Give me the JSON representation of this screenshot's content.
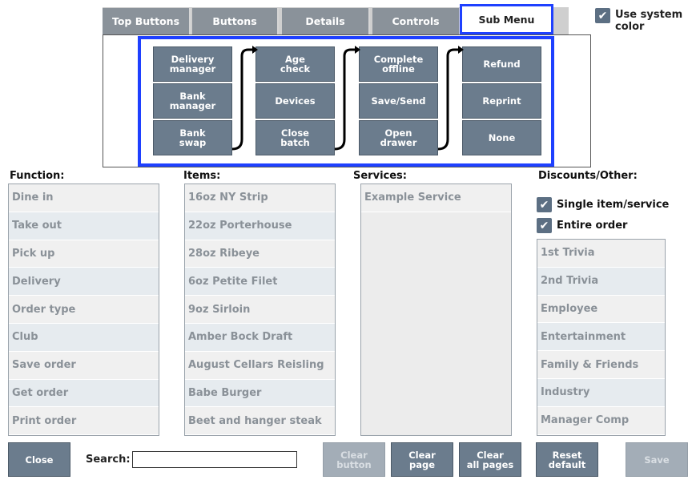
{
  "tabs": [
    {
      "label": "Top Buttons"
    },
    {
      "label": "Buttons"
    },
    {
      "label": "Details"
    },
    {
      "label": "Controls"
    },
    {
      "label": "Sub Menu"
    }
  ],
  "use_system_color": {
    "label": "Use system color",
    "checked": true
  },
  "submenu": {
    "columns": [
      [
        "Delivery\nmanager",
        "Bank\nmanager",
        "Bank\nswap"
      ],
      [
        "Age\ncheck",
        "Devices",
        "Close\nbatch"
      ],
      [
        "Complete\noffline",
        "Save/Send",
        "Open\ndrawer"
      ],
      [
        "Refund",
        "Reprint",
        "None"
      ]
    ]
  },
  "function": {
    "title": "Function:",
    "items": [
      "Dine in",
      "Take out",
      "Pick up",
      "Delivery",
      "Order type",
      "Club",
      "Save order",
      "Get order",
      "Print order"
    ]
  },
  "items": {
    "title": "Items:",
    "items": [
      "16oz NY Strip",
      "22oz Porterhouse",
      "28oz Ribeye",
      "6oz Petite Filet",
      "9oz Sirloin",
      "Amber Bock Draft",
      "August Cellars Reisling",
      "Babe Burger",
      "Beet and hanger steak"
    ]
  },
  "services": {
    "title": "Services:",
    "items": [
      "Example Service"
    ]
  },
  "discounts": {
    "title": "Discounts/Other:",
    "single_item": {
      "label": "Single item/service",
      "checked": true
    },
    "entire_order": {
      "label": "Entire order",
      "checked": true
    },
    "items": [
      "1st Trivia",
      "2nd Trivia",
      "Employee",
      "Entertainment",
      "Family & Friends",
      "Industry",
      "Manager Comp"
    ]
  },
  "bottom": {
    "close": "Close",
    "search_label": "Search:",
    "search_value": "",
    "clear_button": "Clear\nbutton",
    "clear_page": "Clear\npage",
    "clear_all_pages": "Clear\nall pages",
    "reset_default": "Reset\ndefault",
    "save": "Save"
  },
  "check_glyph": "✔",
  "colors": {
    "accent_highlight": "#1e40ff",
    "button": "#6b7c8d",
    "button_disabled": "#a3adb7",
    "tab": "#8a929a"
  }
}
